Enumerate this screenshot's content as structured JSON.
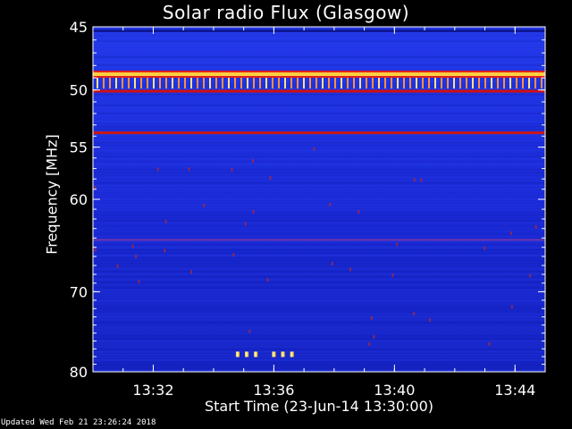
{
  "chart_data": {
    "type": "heatmap",
    "title": "Solar radio Flux (Glasgow)",
    "xlabel": "Start Time (23-Jun-14 13:30:00)",
    "ylabel": "Frequency [MHz]",
    "x_range_minutes": [
      0,
      15
    ],
    "x_ticks": [
      {
        "minute": 2,
        "label": "13:32"
      },
      {
        "minute": 6,
        "label": "13:36"
      },
      {
        "minute": 10,
        "label": "13:40"
      },
      {
        "minute": 14,
        "label": "13:44"
      }
    ],
    "y_range_mhz": [
      45,
      80
    ],
    "y_scale": "log",
    "y_ticks": [
      {
        "value": 45,
        "label": "45"
      },
      {
        "value": 50,
        "label": "50"
      },
      {
        "value": 55,
        "label": "55"
      },
      {
        "value": 60,
        "label": "60"
      },
      {
        "value": 70,
        "label": "70"
      },
      {
        "value": 80,
        "label": "80"
      }
    ],
    "background_color": "#1a2ad6",
    "emission_bands": [
      {
        "freq_mhz": 48.7,
        "color": "#ffd040",
        "intensity": "high"
      },
      {
        "freq_mhz": 50.1,
        "color": "#d01010",
        "intensity": "medium"
      },
      {
        "freq_mhz": 53.7,
        "color": "#c81818",
        "intensity": "medium"
      },
      {
        "freq_mhz": 64.2,
        "color": "#8a3aa8",
        "intensity": "low"
      }
    ],
    "bursts": [
      {
        "minute": 4.8,
        "freq_mhz": 77.7
      },
      {
        "minute": 5.1,
        "freq_mhz": 77.7
      },
      {
        "minute": 5.4,
        "freq_mhz": 77.7
      },
      {
        "minute": 6.0,
        "freq_mhz": 77.7
      },
      {
        "minute": 6.3,
        "freq_mhz": 77.7
      },
      {
        "minute": 6.6,
        "freq_mhz": 77.7
      }
    ]
  },
  "footer": {
    "updated_text": "Updated Wed Feb 21 23:26:24 2018"
  }
}
